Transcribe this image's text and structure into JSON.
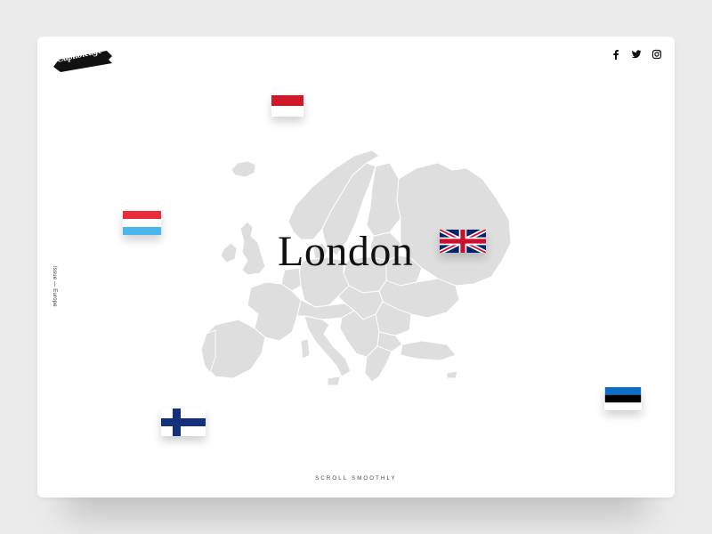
{
  "brand": {
    "logo_text": "Capitoledge",
    "logo_color": "#111111"
  },
  "social": [
    {
      "name": "facebook-icon"
    },
    {
      "name": "twitter-icon"
    },
    {
      "name": "instagram-icon"
    }
  ],
  "side_label": "Issue — Europe",
  "hero": {
    "city": "London"
  },
  "flags": [
    {
      "country": "Indonesia"
    },
    {
      "country": "Luxembourg"
    },
    {
      "country": "United Kingdom"
    },
    {
      "country": "Finland"
    },
    {
      "country": "Estonia"
    }
  ],
  "footer": {
    "scroll_text": "SCROLL SMOOTHLY"
  },
  "colors": {
    "background": "#ebebeb",
    "card": "#ffffff",
    "map_fill": "#dedede",
    "map_stroke": "#ffffff"
  }
}
